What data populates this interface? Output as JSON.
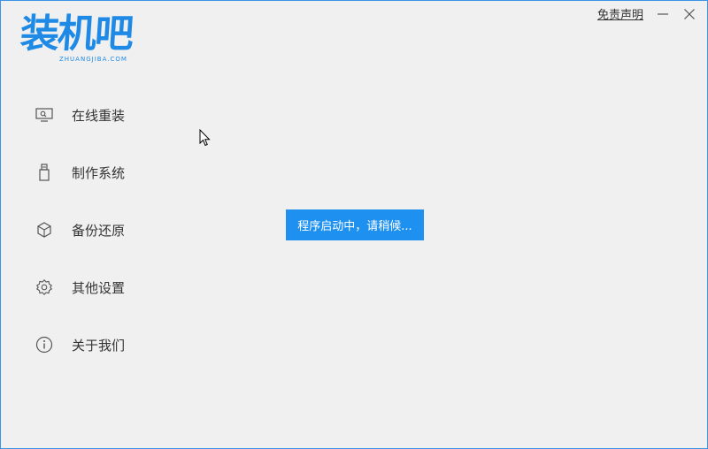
{
  "logo": {
    "name_cn": "装机吧",
    "name_en": "ZHUANGJIBA.COM"
  },
  "titlebar": {
    "disclaimer": "免责声明",
    "minimize_icon": "minimize-icon",
    "close_icon": "close-icon"
  },
  "menu": {
    "items": [
      {
        "label": "在线重装",
        "icon": "monitor-icon"
      },
      {
        "label": "制作系统",
        "icon": "usb-drive-icon"
      },
      {
        "label": "备份还原",
        "icon": "backup-cube-icon"
      },
      {
        "label": "其他设置",
        "icon": "gear-icon"
      },
      {
        "label": "关于我们",
        "icon": "info-icon"
      }
    ]
  },
  "toast": {
    "text": "程序启动中，请稍候..."
  },
  "colors": {
    "accent": "#1e8ae6",
    "toast_bg": "#1e90f0",
    "window_bg": "#f0f0f0",
    "text": "#333333"
  }
}
